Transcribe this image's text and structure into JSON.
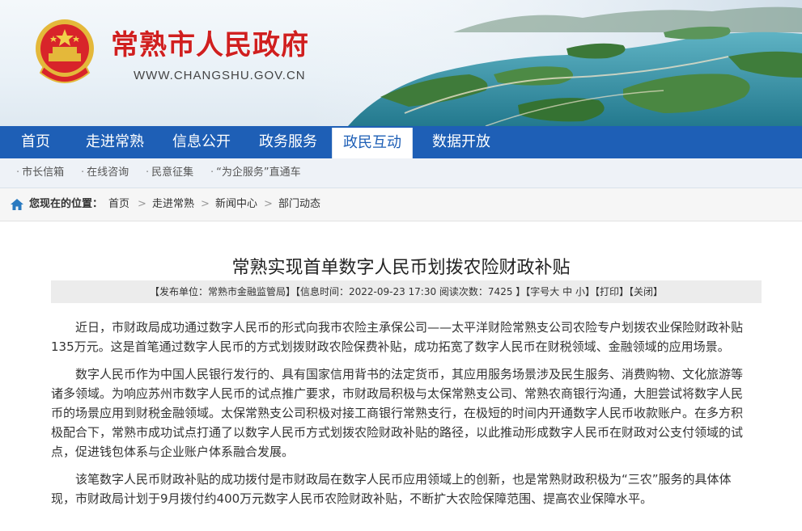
{
  "header": {
    "site_title": "常熟市人民政府",
    "site_url": "WWW.CHANGSHU.GOV.CN",
    "emblem_icon": "national-emblem-icon",
    "banner_scene": "aerial-lake-islands",
    "colors": {
      "title_red": "#d01f1f",
      "water": "#2f8fa3"
    }
  },
  "nav": {
    "items": [
      {
        "label": "首页"
      },
      {
        "label": "走进常熟"
      },
      {
        "label": "信息公开"
      },
      {
        "label": "政务服务"
      },
      {
        "label": "政民互动"
      },
      {
        "label": "数据开放"
      }
    ],
    "active": "政民互动",
    "color": "#1e5fb6"
  },
  "subnav": {
    "items": [
      {
        "label": "市长信箱"
      },
      {
        "label": "在线咨询"
      },
      {
        "label": "民意征集"
      },
      {
        "label": "“为企服务”直通车"
      }
    ]
  },
  "breadcrumb": {
    "label": "您现在的位置：",
    "items": [
      {
        "label": "首页"
      },
      {
        "label": "走进常熟"
      },
      {
        "label": "新闻中心"
      },
      {
        "label": "部门动态"
      }
    ],
    "separator": ">"
  },
  "article": {
    "title": "常熟实现首单数字人民币划拨农险财政补贴",
    "meta": {
      "publisher": "【发布单位：常熟市金融监管局】",
      "time": "【信息时间：2022-09-23 17:30 阅读次数：7425 】",
      "font_prefix": "【字号",
      "font_large": "大",
      "font_medium": "中",
      "font_small": "小",
      "font_suffix": "】",
      "print": "【打印】",
      "close": "【关闭】"
    },
    "paragraphs": [
      "近日，市财政局成功通过数字人民币的形式向我市农险主承保公司——太平洋财险常熟支公司农险专户划拨农业保险财政补贴135万元。这是首笔通过数字人民币的方式划拨财政农险保费补贴，成功拓宽了数字人民币在财税领域、金融领域的应用场景。",
      "数字人民币作为中国人民银行发行的、具有国家信用背书的法定货币，其应用服务场景涉及民生服务、消费购物、文化旅游等诸多领域。为响应苏州市数字人民币的试点推广要求，市财政局积极与太保常熟支公司、常熟农商银行沟通，大胆尝试将数字人民币的场景应用到财税金融领域。太保常熟支公司积极对接工商银行常熟支行，在极短的时间内开通数字人民币收款账户。在多方积极配合下，常熟市成功试点打通了以数字人民币方式划拨农险财政补贴的路径，以此推动形成数字人民币在财政对公支付领域的试点，促进钱包体系与企业账户体系融合发展。",
      "该笔数字人民币财政补贴的成功拨付是市财政局在数字人民币应用领域上的创新，也是常熟财政积极为“三农”服务的具体体现，市财政局计划于9月拨付约400万元数字人民币农险财政补贴，不断扩大农险保障范围、提高农业保障水平。"
    ]
  }
}
